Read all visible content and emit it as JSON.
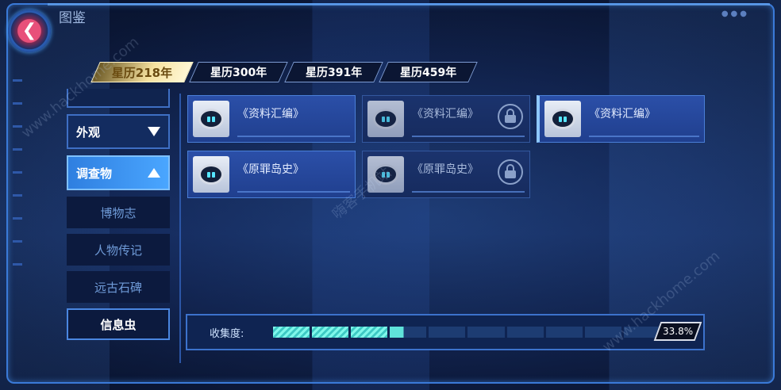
{
  "window": {
    "title": "图鉴"
  },
  "tabs": [
    "星历218年",
    "星历300年",
    "星历391年",
    "星历459年"
  ],
  "sidebar": {
    "appearance": "外观",
    "investigation": "调查物",
    "sub_items": [
      "博物志",
      "人物传记",
      "远古石碑",
      "信息虫"
    ]
  },
  "cards": [
    {
      "name": "《资料汇编》",
      "locked": false,
      "selected": false
    },
    {
      "name": "《资料汇编》",
      "locked": true,
      "selected": false
    },
    {
      "name": "《资料汇编》",
      "locked": false,
      "selected": true
    },
    {
      "name": "《原罪岛史》",
      "locked": false,
      "selected": false
    },
    {
      "name": "《原罪岛史》",
      "locked": true,
      "selected": false
    }
  ],
  "collection": {
    "label": "收集度:",
    "percent_text": "33.8%",
    "value": 0.338
  },
  "watermarks": [
    "www.hackhome.com",
    "嗨客手机站",
    "www.hackhome.com"
  ],
  "colors": {
    "accent": "#4aa6ff",
    "progress_fill": "#7ff7ea",
    "active_tab": "#f6e2a0"
  }
}
